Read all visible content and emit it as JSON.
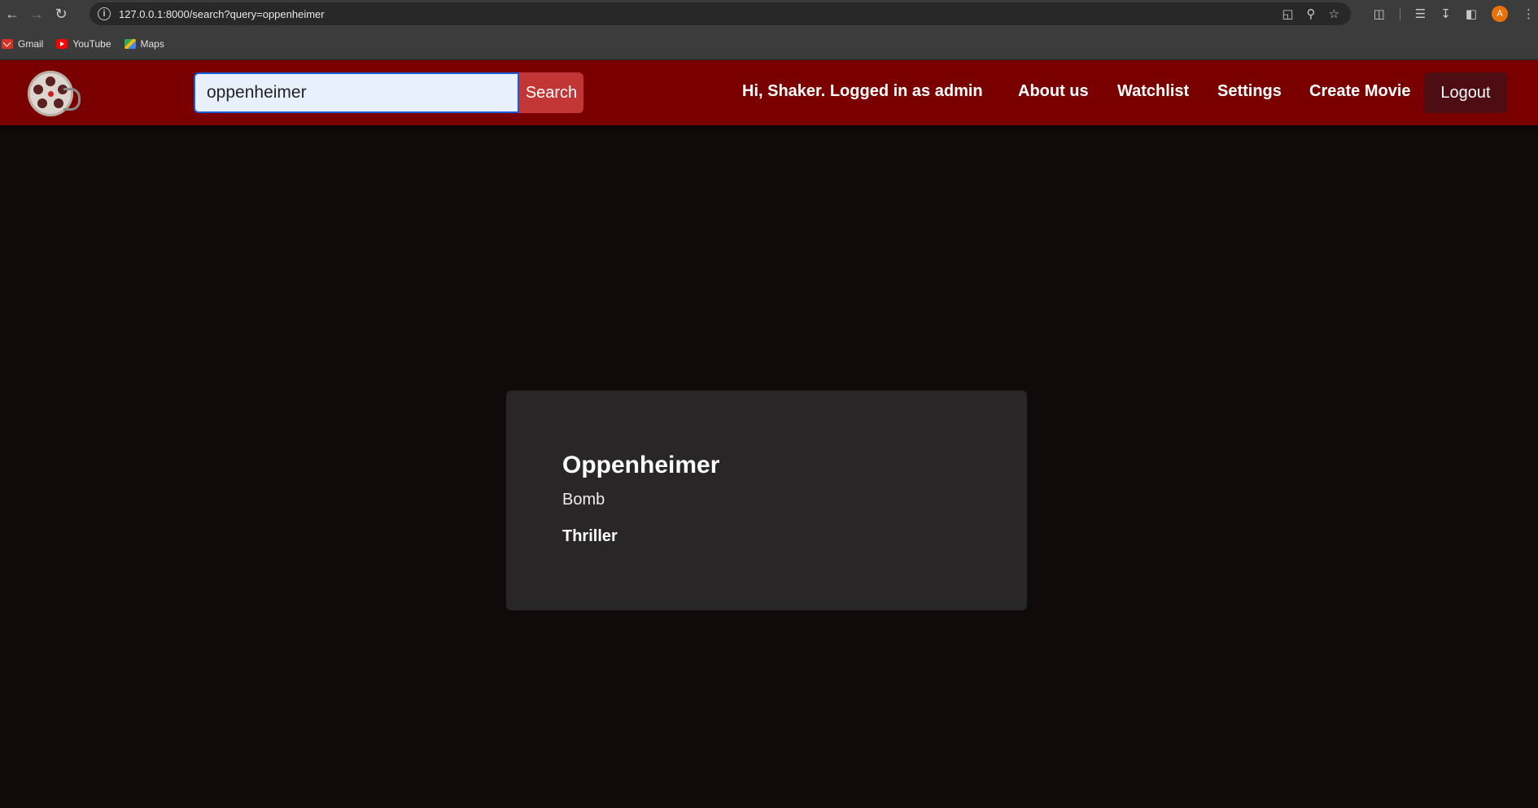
{
  "browser": {
    "url": "127.0.0.1:8000/search?query=oppenheimer",
    "bookmarks": [
      {
        "label": "Gmail",
        "icon": "gmail-icon"
      },
      {
        "label": "YouTube",
        "icon": "youtube-icon"
      },
      {
        "label": "Maps",
        "icon": "maps-icon"
      }
    ],
    "profile_initial": "A"
  },
  "header": {
    "search": {
      "value": "oppenheimer",
      "button_label": "Search"
    },
    "greeting": "Hi, Shaker. Logged in as admin",
    "nav": {
      "about": "About us",
      "watchlist": "Watchlist",
      "settings": "Settings",
      "create_movie": "Create Movie",
      "logout": "Logout"
    },
    "colors": {
      "header_bg": "#7a0000",
      "search_button": "#c23636",
      "logout_bg": "#4e0d12"
    }
  },
  "results": [
    {
      "title": "Oppenheimer",
      "description": "Bomb",
      "genre": "Thriller"
    }
  ]
}
